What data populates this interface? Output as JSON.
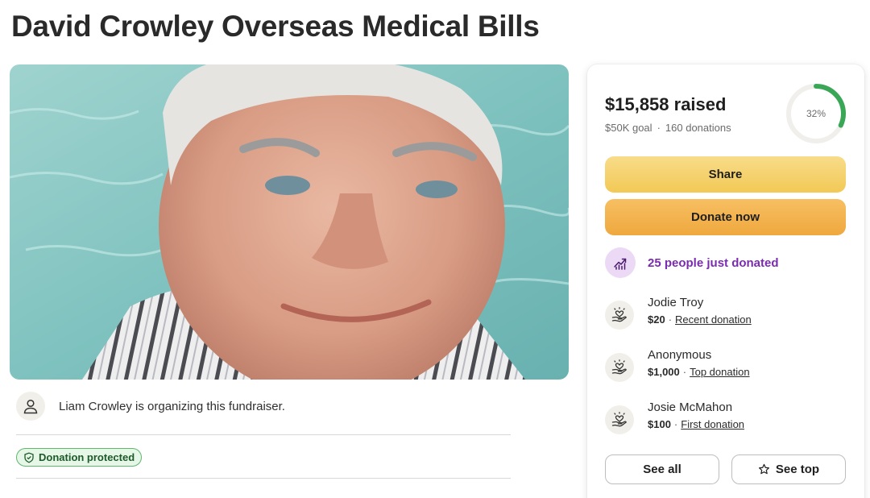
{
  "campaign": {
    "title": "David Crowley Overseas Medical Bills",
    "organizer_text": "Liam Crowley is organizing this fundraiser.",
    "protected_label": "Donation protected"
  },
  "stats": {
    "raised": "$15,858 raised",
    "goal": "$50K goal",
    "separator": "·",
    "donations": "160 donations",
    "percent_label": "32%",
    "progress_fraction": 0.32
  },
  "actions": {
    "share_label": "Share",
    "donate_label": "Donate now",
    "see_all_label": "See all",
    "see_top_label": "See top"
  },
  "activity": {
    "trend_label": "25 people just donated"
  },
  "donors": [
    {
      "name": "Jodie Troy",
      "amount": "$20",
      "sep": "·",
      "kind": "Recent donation"
    },
    {
      "name": "Anonymous",
      "amount": "$1,000",
      "sep": "·",
      "kind": "Top donation"
    },
    {
      "name": "Josie McMahon",
      "amount": "$100",
      "sep": "·",
      "kind": "First donation"
    }
  ],
  "colors": {
    "progress": "#3aa757",
    "accent_purple": "#7a2bb0",
    "share_button": "#f5d26e",
    "donate_button": "#f2b24b",
    "protected_green": "#5fb76e"
  },
  "icons": {
    "organizer": "user-icon",
    "protected": "shield-icon",
    "trend": "trending-up-icon",
    "donor": "heart-hand-icon",
    "see_top": "star-icon"
  }
}
